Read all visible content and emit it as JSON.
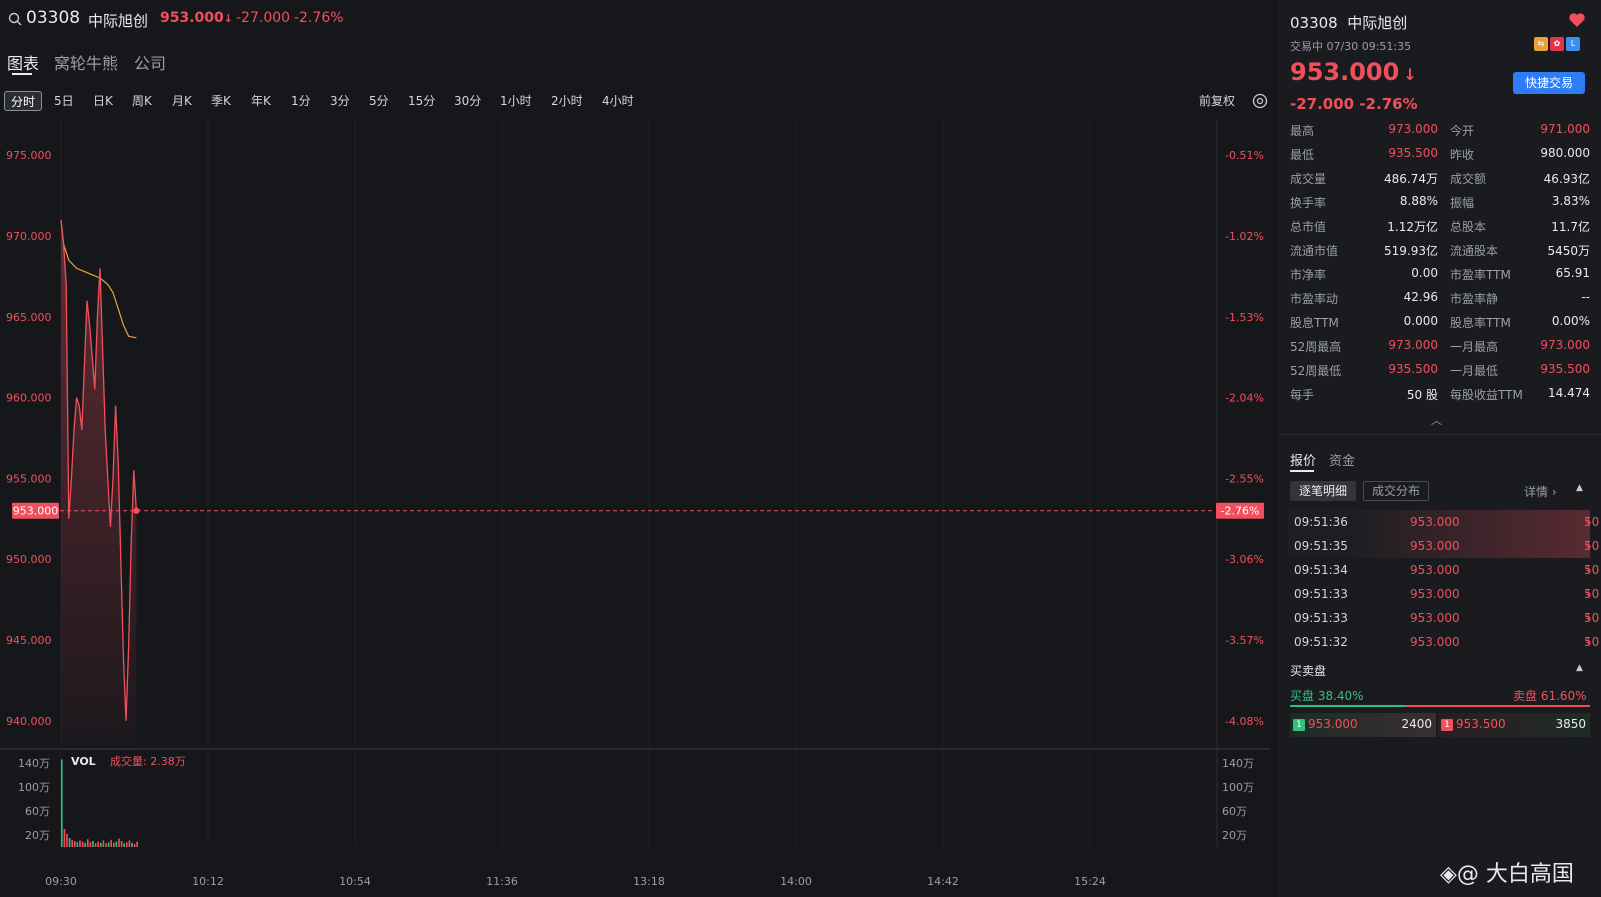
{
  "header": {
    "symbol": "03308",
    "name": "中际旭创",
    "price": "953.000",
    "change": "-27.000",
    "change_pct": "-2.76%"
  },
  "tabs": [
    {
      "label": "图表",
      "active": true
    },
    {
      "label": "窝轮牛熊",
      "active": false
    },
    {
      "label": "公司",
      "active": false
    }
  ],
  "periods": [
    {
      "label": "分时",
      "active": true
    },
    {
      "label": "5日"
    },
    {
      "label": "日K"
    },
    {
      "label": "周K"
    },
    {
      "label": "月K"
    },
    {
      "label": "季K"
    },
    {
      "label": "年K"
    },
    {
      "label": "1分"
    },
    {
      "label": "3分"
    },
    {
      "label": "5分"
    },
    {
      "label": "15分"
    },
    {
      "label": "30分"
    },
    {
      "label": "1小时"
    },
    {
      "label": "2小时"
    },
    {
      "label": "4小时"
    }
  ],
  "adjust_label": "前复权",
  "chart_data": {
    "type": "line",
    "price_axis": [
      "975.000",
      "970.000",
      "965.000",
      "960.000",
      "955.000",
      "950.000",
      "945.000",
      "940.000"
    ],
    "pct_axis": [
      "-0.51%",
      "-1.02%",
      "-1.53%",
      "-2.04%",
      "-2.55%",
      "-3.06%",
      "-3.57%",
      "-4.08%"
    ],
    "current_price_label": "953.000",
    "current_pct_label": "-2.76%",
    "x_ticks": [
      "09:30",
      "10:12",
      "10:54",
      "11:36",
      "13:18",
      "14:00",
      "14:42",
      "15:24"
    ],
    "ylim": [
      938.5,
      976.5
    ],
    "price_series": [
      {
        "t": 0,
        "v": 971.0
      },
      {
        "t": 1,
        "v": 969.5
      },
      {
        "t": 2,
        "v": 967.0
      },
      {
        "t": 3,
        "v": 952.5
      },
      {
        "t": 4,
        "v": 955.0
      },
      {
        "t": 5,
        "v": 958.0
      },
      {
        "t": 6,
        "v": 960.0
      },
      {
        "t": 7,
        "v": 959.5
      },
      {
        "t": 8,
        "v": 958.0
      },
      {
        "t": 9,
        "v": 962.0
      },
      {
        "t": 10,
        "v": 966.0
      },
      {
        "t": 11,
        "v": 964.5
      },
      {
        "t": 12,
        "v": 962.5
      },
      {
        "t": 13,
        "v": 960.5
      },
      {
        "t": 14,
        "v": 965.0
      },
      {
        "t": 15,
        "v": 968.0
      },
      {
        "t": 16,
        "v": 963.0
      },
      {
        "t": 17,
        "v": 958.0
      },
      {
        "t": 18,
        "v": 955.0
      },
      {
        "t": 19,
        "v": 952.0
      },
      {
        "t": 20,
        "v": 955.0
      },
      {
        "t": 21,
        "v": 959.5
      },
      {
        "t": 22,
        "v": 956.0
      },
      {
        "t": 23,
        "v": 950.0
      },
      {
        "t": 24,
        "v": 944.0
      },
      {
        "t": 25,
        "v": 940.0
      },
      {
        "t": 26,
        "v": 944.5
      },
      {
        "t": 27,
        "v": 951.0
      },
      {
        "t": 28,
        "v": 955.5
      },
      {
        "t": 29,
        "v": 953.0
      }
    ],
    "avg_series": [
      {
        "t": 0,
        "v": 971.0
      },
      {
        "t": 1,
        "v": 969.5
      },
      {
        "t": 3,
        "v": 968.5
      },
      {
        "t": 6,
        "v": 968.0
      },
      {
        "t": 9,
        "v": 967.8
      },
      {
        "t": 12,
        "v": 967.6
      },
      {
        "t": 15,
        "v": 967.4
      },
      {
        "t": 18,
        "v": 967.0
      },
      {
        "t": 20,
        "v": 966.5
      },
      {
        "t": 22,
        "v": 965.5
      },
      {
        "t": 24,
        "v": 964.5
      },
      {
        "t": 26,
        "v": 963.8
      },
      {
        "t": 29,
        "v": 963.7
      }
    ],
    "vol_label": "VOL",
    "vol_total_label": "成交量: 2.38万",
    "vol_axis": [
      "140万",
      "100万",
      "60万",
      "20万"
    ],
    "vol_ylim": [
      0,
      150
    ],
    "vol_series": [
      146,
      30,
      22,
      15,
      12,
      10,
      8,
      11,
      9,
      7,
      13,
      8,
      10,
      6,
      9,
      7,
      11,
      6,
      8,
      12,
      7,
      9,
      14,
      10,
      6,
      8,
      11,
      7,
      5,
      9
    ],
    "colors": {
      "price_line": "#f0505c",
      "avg_line": "#e8a33b",
      "vol_up": "#2ec27e",
      "vol_down": "#f0505c"
    }
  },
  "right": {
    "symbol": "03308",
    "name": "中际旭创",
    "status": "交易中 07/30 09:51:35",
    "price": "953.000",
    "change": "-27.000 -2.76%",
    "trade_button": "快捷交易",
    "stats": [
      {
        "k1": "最高",
        "v1": "973.000",
        "c1": "red",
        "k2": "今开",
        "v2": "971.000",
        "c2": "red"
      },
      {
        "k1": "最低",
        "v1": "935.500",
        "c1": "red",
        "k2": "昨收",
        "v2": "980.000",
        "c2": "white"
      },
      {
        "k1": "成交量",
        "v1": "486.74万",
        "c1": "white",
        "k2": "成交额",
        "v2": "46.93亿",
        "c2": "white"
      },
      {
        "k1": "换手率",
        "v1": "8.88%",
        "c1": "white",
        "k2": "振幅",
        "v2": "3.83%",
        "c2": "white"
      },
      {
        "k1": "总市值",
        "v1": "1.12万亿",
        "c1": "white",
        "k2": "总股本",
        "v2": "11.7亿",
        "c2": "white"
      },
      {
        "k1": "流通市值",
        "v1": "519.93亿",
        "c1": "white",
        "k2": "流通股本",
        "v2": "5450万",
        "c2": "white"
      },
      {
        "k1": "市净率",
        "v1": "0.00",
        "c1": "white",
        "k2": "市盈率TTM",
        "v2": "65.91",
        "c2": "white"
      },
      {
        "k1": "市盈率动",
        "v1": "42.96",
        "c1": "white",
        "k2": "市盈率静",
        "v2": "--",
        "c2": "white"
      },
      {
        "k1": "股息TTM",
        "v1": "0.000",
        "c1": "white",
        "k2": "股息率TTM",
        "v2": "0.00%",
        "c2": "white"
      },
      {
        "k1": "52周最高",
        "v1": "973.000",
        "c1": "red",
        "k2": "一月最高",
        "v2": "973.000",
        "c2": "red"
      },
      {
        "k1": "52周最低",
        "v1": "935.500",
        "c1": "red",
        "k2": "一月最低",
        "v2": "935.500",
        "c2": "red"
      },
      {
        "k1": "每手",
        "v1": "50 股",
        "c1": "white",
        "k2": "每股收益TTM",
        "v2": "14.474",
        "c2": "white"
      }
    ],
    "tabs": [
      {
        "label": "报价",
        "active": true
      },
      {
        "label": "资金",
        "active": false
      }
    ],
    "sub_buttons": [
      {
        "label": "逐笔明细",
        "active": true
      },
      {
        "label": "成交分布",
        "active": false
      }
    ],
    "details_link": "详情 ›",
    "ticks": [
      {
        "time": "09:51:36",
        "price": "953.000",
        "vol": "50",
        "hl": true
      },
      {
        "time": "09:51:35",
        "price": "953.000",
        "vol": "50",
        "hl": true
      },
      {
        "time": "09:51:34",
        "price": "953.000",
        "vol": "50",
        "hl": false
      },
      {
        "time": "09:51:33",
        "price": "953.000",
        "vol": "50",
        "hl": false
      },
      {
        "time": "09:51:33",
        "price": "953.000",
        "vol": "50",
        "hl": false
      },
      {
        "time": "09:51:32",
        "price": "953.000",
        "vol": "50",
        "hl": false
      }
    ],
    "order_book": {
      "title": "买卖盘",
      "buy_label": "买盘 38.40%",
      "sell_label": "卖盘 61.60%",
      "buy_ratio": 0.384,
      "bid_level": "1",
      "bid_price": "953.000",
      "bid_vol": "2400",
      "ask_level": "1",
      "ask_price": "953.500",
      "ask_vol": "3850"
    }
  },
  "watermark": "@ 大白高国"
}
